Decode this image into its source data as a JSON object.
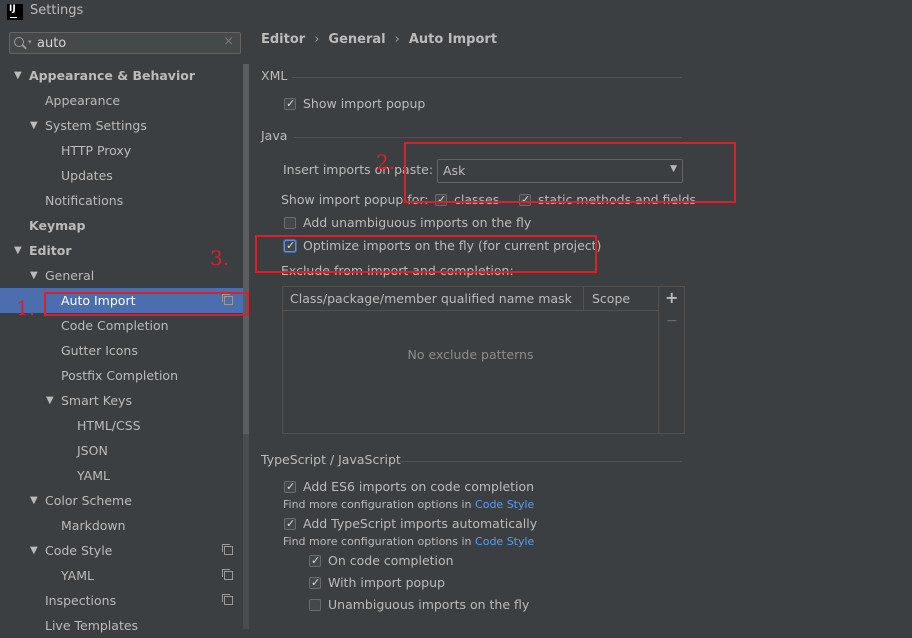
{
  "window": {
    "title": "Settings"
  },
  "search": {
    "value": "auto"
  },
  "tree": [
    {
      "label": "Appearance & Behavior",
      "arrow": "▼",
      "level": 0,
      "bold": true
    },
    {
      "label": "Appearance",
      "arrow": "",
      "level": 1
    },
    {
      "label": "System Settings",
      "arrow": "▼",
      "level": 1
    },
    {
      "label": "HTTP Proxy",
      "arrow": "",
      "level": 2
    },
    {
      "label": "Updates",
      "arrow": "",
      "level": 2
    },
    {
      "label": "Notifications",
      "arrow": "",
      "level": 1
    },
    {
      "label": "Keymap",
      "arrow": "",
      "level": 0,
      "bold": true
    },
    {
      "label": "Editor",
      "arrow": "▼",
      "level": 0,
      "bold": true
    },
    {
      "label": "General",
      "arrow": "▼",
      "level": 1
    },
    {
      "label": "Auto Import",
      "arrow": "",
      "level": 2,
      "selected": true,
      "icon": true
    },
    {
      "label": "Code Completion",
      "arrow": "",
      "level": 2
    },
    {
      "label": "Gutter Icons",
      "arrow": "",
      "level": 2
    },
    {
      "label": "Postfix Completion",
      "arrow": "",
      "level": 2
    },
    {
      "label": "Smart Keys",
      "arrow": "▼",
      "level": 2
    },
    {
      "label": "HTML/CSS",
      "arrow": "",
      "level": 3
    },
    {
      "label": "JSON",
      "arrow": "",
      "level": 3
    },
    {
      "label": "YAML",
      "arrow": "",
      "level": 3
    },
    {
      "label": "Color Scheme",
      "arrow": "▼",
      "level": 1
    },
    {
      "label": "Markdown",
      "arrow": "",
      "level": 2
    },
    {
      "label": "Code Style",
      "arrow": "▼",
      "level": 1,
      "icon": true
    },
    {
      "label": "YAML",
      "arrow": "",
      "level": 2,
      "icon": true
    },
    {
      "label": "Inspections",
      "arrow": "",
      "level": 1,
      "icon": true
    },
    {
      "label": "Live Templates",
      "arrow": "",
      "level": 1
    }
  ],
  "breadcrumb": {
    "editor": "Editor",
    "general": "General",
    "current": "Auto Import"
  },
  "xml": {
    "title": "XML",
    "show_import_popup": {
      "label": "Show import popup",
      "checked": true
    }
  },
  "java": {
    "title": "Java",
    "insert_label": "Insert imports on paste:",
    "insert_value": "Ask",
    "show_popup_label": "Show import popup for:",
    "classes": {
      "label": "classes",
      "checked": true
    },
    "static_methods": {
      "label": "static methods and fields",
      "checked": true
    },
    "unambiguous": {
      "label": "Add unambiguous imports on the fly",
      "checked": false
    },
    "optimize": {
      "label": "Optimize imports on the fly (for current project)",
      "checked": true
    },
    "exclude_label": "Exclude from import and completion:",
    "table": {
      "col_mask": "Class/package/member qualified name mask",
      "col_scope": "Scope",
      "empty": "No exclude patterns",
      "add": "+",
      "remove": "−"
    }
  },
  "ts": {
    "title": "TypeScript / JavaScript",
    "es6": {
      "label": "Add ES6 imports on code completion",
      "checked": true
    },
    "hint1": "Find more configuration options in",
    "hint_link": "Code Style",
    "ts_auto": {
      "label": "Add TypeScript imports automatically",
      "checked": true
    },
    "hint2": "Find more configuration options in",
    "on_completion": {
      "label": "On code completion",
      "checked": true
    },
    "with_popup": {
      "label": "With import popup",
      "checked": true
    },
    "unambiguous": {
      "label": "Unambiguous imports on the fly",
      "checked": false
    }
  },
  "annotations": {
    "n1": "1.",
    "n2": "2.",
    "n3": "3.",
    "color": "#d9212b"
  },
  "colors": {
    "selection": "#4b6eaf",
    "background": "#3c3f41",
    "link": "#589df6"
  },
  "icons": {
    "app": "intellij-logo",
    "search": "search-icon",
    "copy": "copy-icon"
  }
}
